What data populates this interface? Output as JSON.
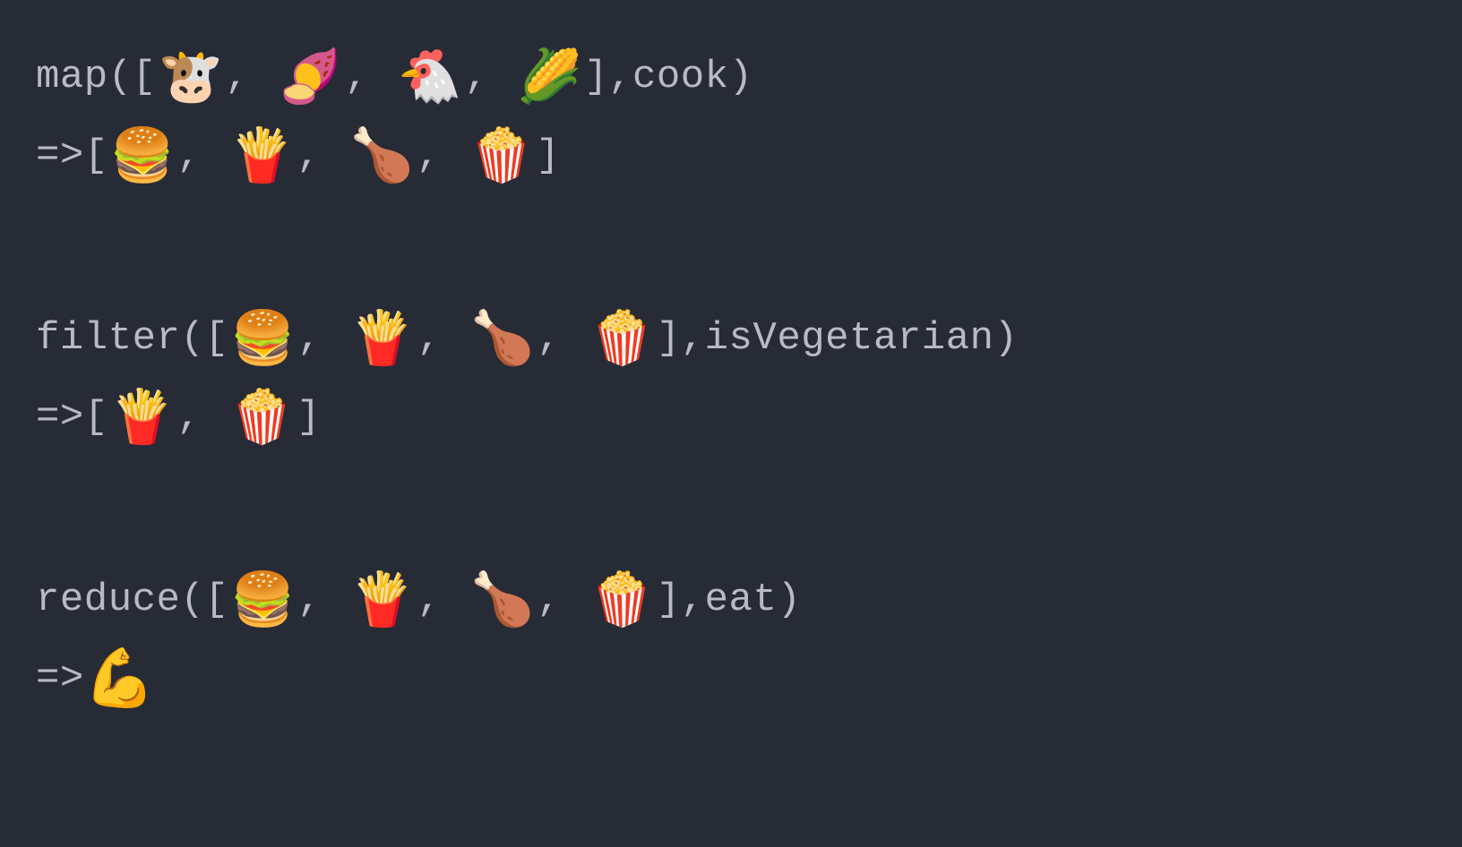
{
  "examples": {
    "map": {
      "fn": "map",
      "open": "([",
      "items": [
        "🐮",
        "🍠",
        "🐔",
        "🌽"
      ],
      "sep": ",",
      "close": "], ",
      "arg": "cook",
      "end": ")",
      "arrow": "=> ",
      "result_open": "[",
      "result_items": [
        "🍔",
        "🍟",
        "🍗",
        "🍿"
      ],
      "result_close": "]"
    },
    "filter": {
      "fn": "filter",
      "open": "([",
      "items": [
        "🍔",
        "🍟",
        "🍗",
        "🍿"
      ],
      "sep": ",",
      "close": "], ",
      "arg": "isVegetarian",
      "end": ")",
      "arrow": "=> ",
      "result_open": "[",
      "result_items": [
        "🍟",
        "🍿"
      ],
      "result_close": "]"
    },
    "reduce": {
      "fn": "reduce",
      "open": "([",
      "items": [
        "🍔",
        "🍟",
        "🍗",
        "🍿"
      ],
      "sep": ",",
      "close": "], ",
      "arg": "eat",
      "end": ")",
      "arrow": "=> ",
      "result_single": "💪"
    }
  }
}
